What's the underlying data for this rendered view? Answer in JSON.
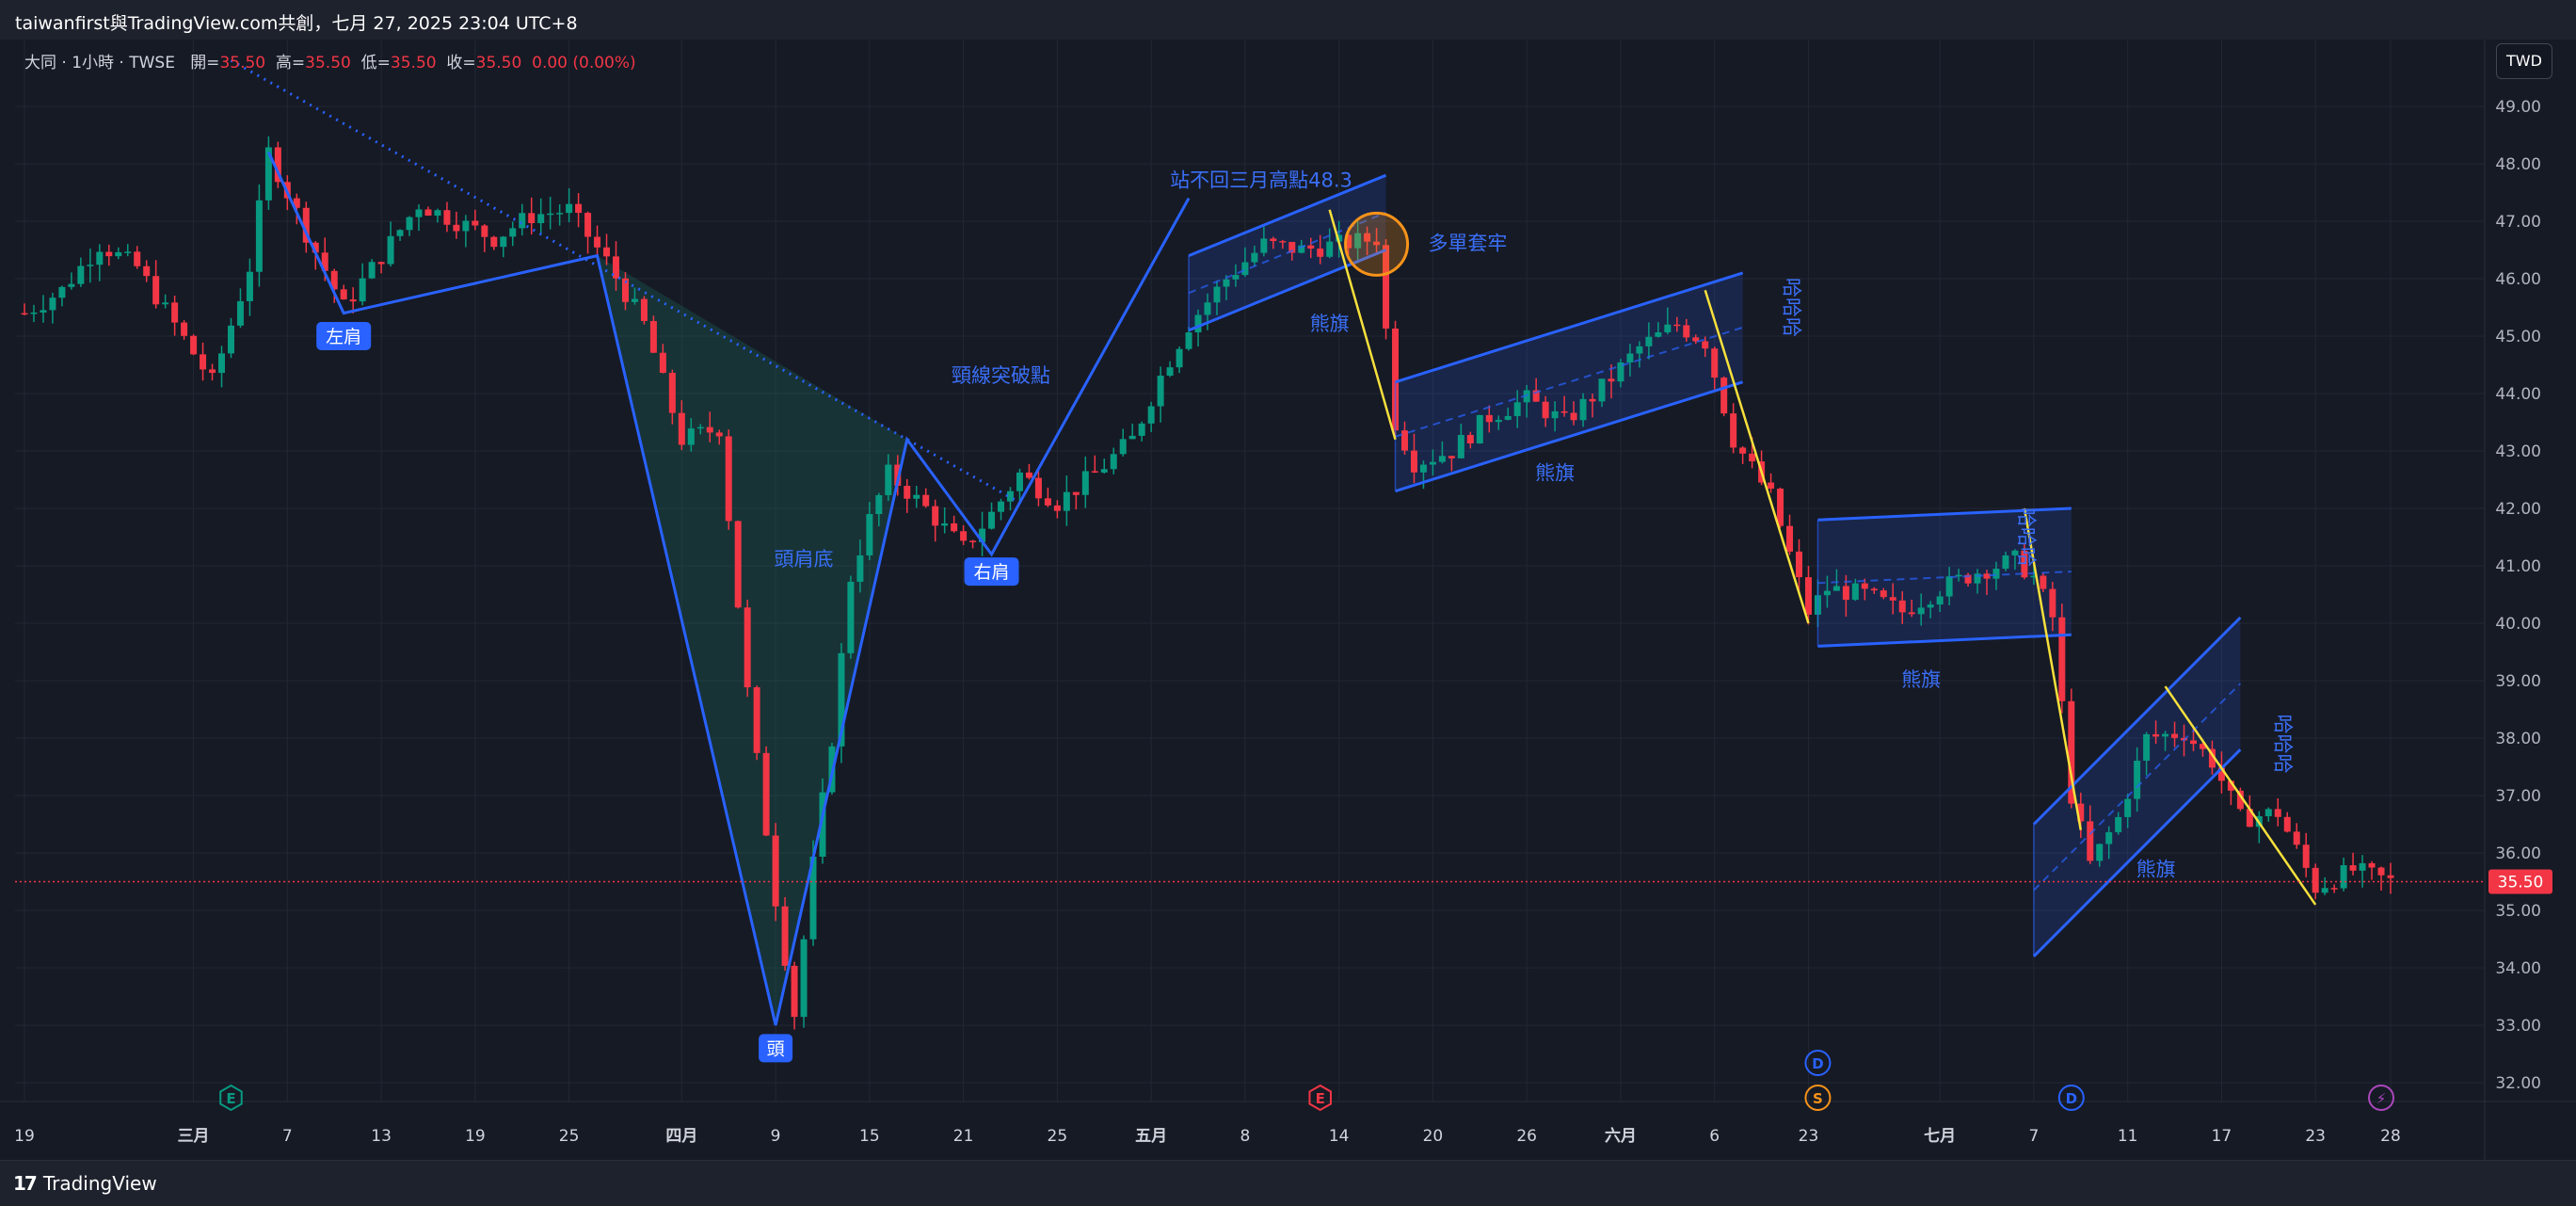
{
  "header": {
    "title": "taiwanfirst與TradingView.com共創，七月 27, 2025 23:04 UTC+8"
  },
  "legend": {
    "symbol_text": "大同 · 1小時 · TWSE",
    "open_label": "開=",
    "open_value": "35.50",
    "high_label": "高=",
    "high_value": "35.50",
    "low_label": "低=",
    "low_value": "35.50",
    "close_label": "收=",
    "close_value": "35.50",
    "change": "0.00 (0.00%)"
  },
  "currency": "TWD",
  "footer": {
    "brand": "TradingView"
  },
  "colors": {
    "up": "#089981",
    "down": "#f23645",
    "pattern": "#2962ff",
    "pattern_text": "#3a6ff7",
    "yellow": "#f7e03c",
    "orange": "#f7931a",
    "grid": "#232733",
    "bg": "#161a25"
  },
  "chart_data": {
    "type": "candlestick",
    "ylim": [
      31.5,
      49.5
    ],
    "yticks": [
      "49.00",
      "48.00",
      "47.00",
      "46.00",
      "45.00",
      "44.00",
      "43.00",
      "42.00",
      "41.00",
      "40.00",
      "39.00",
      "38.00",
      "37.00",
      "36.00",
      "35.00",
      "34.00",
      "33.00",
      "32.00"
    ],
    "last_price": "35.50",
    "x_labels": [
      {
        "i": 0,
        "text": "19",
        "bold": false
      },
      {
        "i": 18,
        "text": "三月",
        "bold": true
      },
      {
        "i": 28,
        "text": "7",
        "bold": false
      },
      {
        "i": 38,
        "text": "13",
        "bold": false
      },
      {
        "i": 48,
        "text": "19",
        "bold": false
      },
      {
        "i": 58,
        "text": "25",
        "bold": false
      },
      {
        "i": 70,
        "text": "四月",
        "bold": true
      },
      {
        "i": 80,
        "text": "9",
        "bold": false
      },
      {
        "i": 90,
        "text": "15",
        "bold": false
      },
      {
        "i": 100,
        "text": "21",
        "bold": false
      },
      {
        "i": 110,
        "text": "25",
        "bold": false
      },
      {
        "i": 120,
        "text": "五月",
        "bold": true
      },
      {
        "i": 130,
        "text": "8",
        "bold": false
      },
      {
        "i": 140,
        "text": "14",
        "bold": false
      },
      {
        "i": 150,
        "text": "20",
        "bold": false
      },
      {
        "i": 160,
        "text": "26",
        "bold": false
      },
      {
        "i": 170,
        "text": "六月",
        "bold": true
      },
      {
        "i": 180,
        "text": "6",
        "bold": false
      },
      {
        "i": 190,
        "text": "23",
        "bold": false
      },
      {
        "i": 204,
        "text": "七月",
        "bold": true
      },
      {
        "i": 214,
        "text": "7",
        "bold": false
      },
      {
        "i": 224,
        "text": "11",
        "bold": false
      },
      {
        "i": 234,
        "text": "17",
        "bold": false
      },
      {
        "i": 244,
        "text": "23",
        "bold": false
      },
      {
        "i": 252,
        "text": "28",
        "bold": false
      }
    ],
    "price_path": [
      [
        0,
        45.4
      ],
      [
        4,
        45.8
      ],
      [
        8,
        46.6
      ],
      [
        12,
        46.2
      ],
      [
        16,
        45.2
      ],
      [
        20,
        44.2
      ],
      [
        24,
        46.2
      ],
      [
        26,
        48.2
      ],
      [
        30,
        46.8
      ],
      [
        34,
        45.5
      ],
      [
        38,
        46.4
      ],
      [
        42,
        47.3
      ],
      [
        46,
        47.0
      ],
      [
        50,
        46.7
      ],
      [
        54,
        47.1
      ],
      [
        58,
        47.2
      ],
      [
        62,
        46.3
      ],
      [
        66,
        45.2
      ],
      [
        70,
        43.2
      ],
      [
        74,
        43.4
      ],
      [
        77,
        38.8
      ],
      [
        80,
        35.2
      ],
      [
        82,
        33.2
      ],
      [
        84,
        35.8
      ],
      [
        86,
        38.0
      ],
      [
        88,
        40.8
      ],
      [
        90,
        41.8
      ],
      [
        92,
        42.6
      ],
      [
        96,
        42.0
      ],
      [
        100,
        41.3
      ],
      [
        103,
        41.9
      ],
      [
        106,
        42.6
      ],
      [
        110,
        42.1
      ],
      [
        114,
        42.6
      ],
      [
        118,
        43.2
      ],
      [
        121,
        44.3
      ],
      [
        124,
        45.2
      ],
      [
        128,
        46.0
      ],
      [
        132,
        46.6
      ],
      [
        136,
        46.5
      ],
      [
        140,
        46.6
      ],
      [
        144,
        46.7
      ],
      [
        146,
        43.5
      ],
      [
        148,
        42.8
      ],
      [
        152,
        43.0
      ],
      [
        156,
        43.6
      ],
      [
        160,
        43.9
      ],
      [
        164,
        43.5
      ],
      [
        168,
        44.1
      ],
      [
        172,
        44.8
      ],
      [
        176,
        45.2
      ],
      [
        179,
        44.9
      ],
      [
        182,
        43.2
      ],
      [
        186,
        42.2
      ],
      [
        190,
        40.2
      ],
      [
        192,
        40.6
      ],
      [
        196,
        40.5
      ],
      [
        200,
        40.2
      ],
      [
        204,
        40.6
      ],
      [
        208,
        40.9
      ],
      [
        212,
        41.1
      ],
      [
        214,
        40.8
      ],
      [
        216,
        40.1
      ],
      [
        218,
        37.0
      ],
      [
        220,
        35.8
      ],
      [
        223,
        36.6
      ],
      [
        226,
        38.0
      ],
      [
        230,
        38.1
      ],
      [
        233,
        37.6
      ],
      [
        236,
        36.6
      ],
      [
        240,
        36.7
      ],
      [
        244,
        35.4
      ],
      [
        248,
        35.7
      ],
      [
        252,
        35.5
      ]
    ],
    "overlays": {
      "head_shoulders": {
        "points": [
          [
            26,
            48.2
          ],
          [
            34,
            45.4
          ],
          [
            61,
            46.4
          ],
          [
            80,
            33.0
          ],
          [
            94,
            43.2
          ],
          [
            103,
            41.2
          ],
          [
            106,
            42.1
          ]
        ],
        "neckline": [
          [
            22,
            49.8
          ],
          [
            106,
            42.1
          ]
        ]
      },
      "breakout_line": [
        [
          106,
          42.1
        ],
        [
          124,
          47.4
        ]
      ],
      "flags": [
        {
          "top": [
            [
              124,
              46.4
            ],
            [
              145,
              47.8
            ]
          ],
          "bottom": [
            [
              124,
              45.1
            ],
            [
              145,
              46.5
            ]
          ],
          "label_at": [
            139,
            45.1
          ]
        },
        {
          "top": [
            [
              146,
              44.2
            ],
            [
              183,
              46.1
            ]
          ],
          "bottom": [
            [
              146,
              42.3
            ],
            [
              183,
              44.2
            ]
          ],
          "label_at": [
            163,
            42.5
          ]
        },
        {
          "top": [
            [
              191,
              41.8
            ],
            [
              218,
              42.0
            ]
          ],
          "bottom": [
            [
              191,
              39.6
            ],
            [
              218,
              39.8
            ]
          ],
          "label_at": [
            202,
            38.9
          ]
        },
        {
          "top": [
            [
              214,
              36.5
            ],
            [
              236,
              40.1
            ]
          ],
          "bottom": [
            [
              214,
              34.2
            ],
            [
              236,
              37.8
            ]
          ],
          "label_at": [
            227,
            35.6
          ]
        }
      ],
      "yellow_lines": [
        [
          [
            139,
            47.2
          ],
          [
            146,
            43.2
          ]
        ],
        [
          [
            179,
            45.8
          ],
          [
            190,
            40.0
          ]
        ],
        [
          [
            213,
            42.0
          ],
          [
            219,
            36.4
          ]
        ],
        [
          [
            228,
            38.9
          ],
          [
            244,
            35.1
          ]
        ]
      ],
      "circle": [
        144,
        46.6
      ]
    },
    "annotations": {
      "left_shoulder": "左肩",
      "head": "頭",
      "right_shoulder": "右肩",
      "inverse_hs": "頭肩底",
      "neckline_break": "頸線突破點",
      "resistance": "站不回三月高點48.3",
      "trapped": "多單套牢",
      "bear_flag": "熊旗",
      "hahaha": "哈哈哈"
    },
    "event_markers": [
      {
        "i": 22,
        "text": "E",
        "color": "#089981",
        "style": "hex"
      },
      {
        "i": 138,
        "text": "E",
        "color": "#f23645",
        "style": "hex"
      },
      {
        "i": 191,
        "text": "D",
        "color": "#2962ff",
        "style": "circle",
        "row": 1
      },
      {
        "i": 191,
        "text": "S",
        "color": "#f7931a",
        "style": "circle"
      },
      {
        "i": 218,
        "text": "D",
        "color": "#2962ff",
        "style": "circle"
      },
      {
        "i": 251,
        "text": "⚡",
        "color": "#ab47bc",
        "style": "circle"
      }
    ]
  }
}
